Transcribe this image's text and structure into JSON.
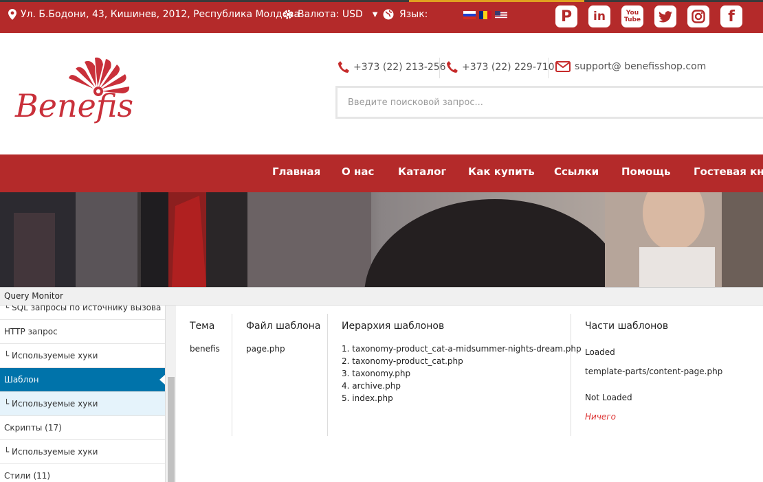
{
  "topbar": {
    "address": "Ул. Б.Бодони, 43, Кишинев, 2012, Республика Молдова",
    "currency": "Валюта: USD",
    "language_label": "Язык:",
    "social": [
      "pinterest",
      "linkedin",
      "youtube",
      "twitter",
      "instagram",
      "facebook"
    ]
  },
  "header": {
    "logo_text": "Benefis",
    "phone1": "+373 (22) 213-256",
    "phone2": "+373 (22) 229-710",
    "email": "support@ benefisshop.com",
    "search_placeholder": "Введите поисковой запрос..."
  },
  "nav": {
    "items": [
      "Главная",
      "О нас",
      "Каталог",
      "Как купить",
      "Ссылки",
      "Помощь",
      "Гостевая книга"
    ]
  },
  "qm": {
    "title": "Query Monitor",
    "sidebar": [
      "└ SQL запросы по источнику вызова",
      "HTTP запрос",
      "└ Используемые хуки",
      "Шаблон",
      "└ Используемые хуки",
      "Скрипты (17)",
      "└ Используемые хуки",
      "Стили (11)"
    ],
    "cols": {
      "theme_h": "Тема",
      "theme_v": "benefis",
      "file_h": "Файл шаблона",
      "file_v": "page.php",
      "hier_h": "Иерархия шаблонов",
      "hier": [
        "1. taxonomy-product_cat-a-midsummer-nights-dream.php",
        "2. taxonomy-product_cat.php",
        "3. taxonomy.php",
        "4. archive.php",
        "5. index.php"
      ],
      "parts_h": "Части шаблонов",
      "loaded_h": "Loaded",
      "loaded_v": "template-parts/content-page.php",
      "notloaded_h": "Not Loaded",
      "notloaded_v": "Ничего"
    }
  },
  "colors": {
    "brand": "#b42a2a",
    "qm_active": "#0073aa",
    "qm_error": "#dd3232"
  }
}
